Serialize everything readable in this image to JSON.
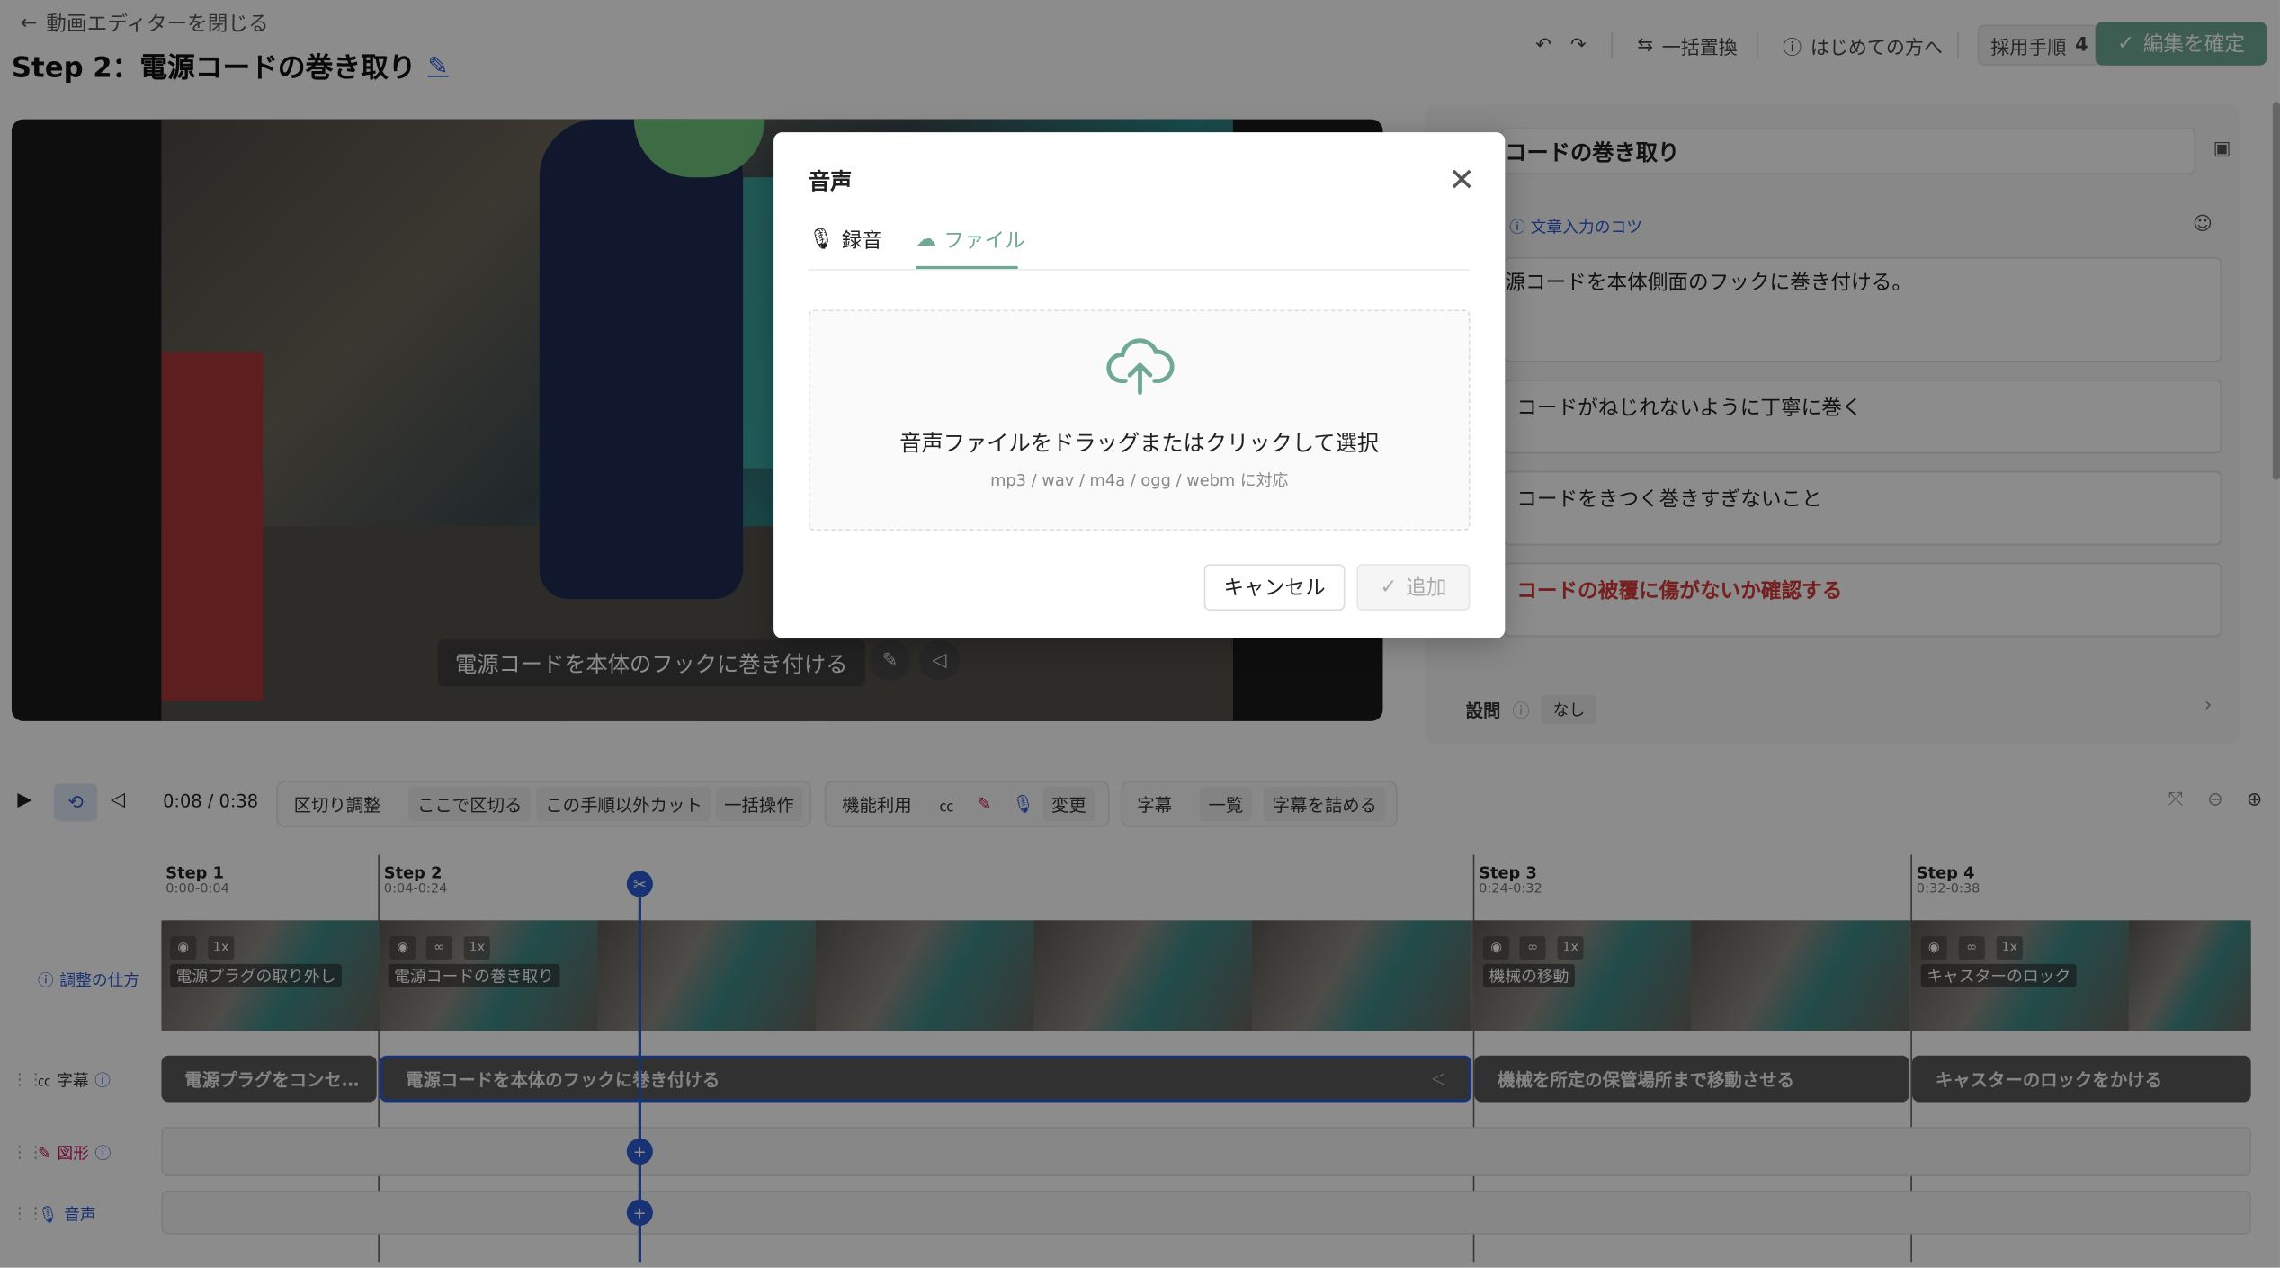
{
  "header": {
    "back_label": "動画エディターを閉じる",
    "title": "Step 2：電源コードの巻き取り",
    "replace_label": "一括置換",
    "beginner_label": "はじめての方へ",
    "adopt_label": "採用手順",
    "adopt_count": "4",
    "confirm_label": "編集を確定"
  },
  "video": {
    "subtitle": "電源コードを本体のフックに巻き付ける"
  },
  "right": {
    "title": "コードの巻き取り",
    "tip": "文章入力のコツ",
    "lines": [
      "源コードを本体側面のフックに巻き付ける。",
      "コードがねじれないように丁寧に巻く",
      "コードをきつく巻きすぎないこと",
      "コードの被覆に傷がないか確認する"
    ],
    "question_label": "設問",
    "question_value": "なし"
  },
  "toolbar": {
    "time": "0:08 / 0:38",
    "b1": "区切り調整",
    "b2": "ここで区切る",
    "b3": "この手順以外カット",
    "b4": "一括操作",
    "b5": "機能利用",
    "b6": "変更",
    "b7": "字幕",
    "b8": "一覧",
    "b9": "字幕を詰める"
  },
  "timeline": {
    "steps": [
      {
        "label": "Step 1",
        "range": "0:00-0:04",
        "name": "電源プラグの取り外し",
        "caption": "電源プラグをコンセ…"
      },
      {
        "label": "Step 2",
        "range": "0:04-0:24",
        "name": "電源コードの巻き取り",
        "caption": "電源コードを本体のフックに巻き付ける"
      },
      {
        "label": "Step 3",
        "range": "0:24-0:32",
        "name": "機械の移動",
        "caption": "機械を所定の保管場所まで移動させる"
      },
      {
        "label": "Step 4",
        "range": "0:32-0:38",
        "name": "キャスターのロック",
        "caption": "キャスターのロックをかける"
      }
    ],
    "speed": "1x",
    "adjust_label": "調整の仕方",
    "track_caption": "字幕",
    "track_shape": "図形",
    "track_audio": "音声"
  },
  "modal": {
    "title": "音声",
    "tab_record": "録音",
    "tab_file": "ファイル",
    "drop_text": "音声ファイルをドラッグまたはクリックして選択",
    "drop_sub": "mp3 / wav / m4a / ogg / webm に対応",
    "cancel": "キャンセル",
    "add": "追加"
  }
}
